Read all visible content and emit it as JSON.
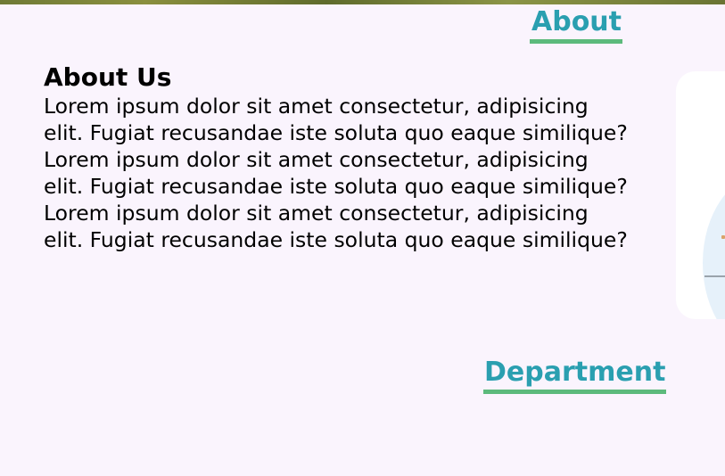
{
  "nav": {
    "about_label": "About",
    "department_label": "Department"
  },
  "about": {
    "title": "About Us",
    "paragraphs": [
      "Lorem ipsum dolor sit amet consectetur, adipisicing elit. Fugiat recusandae iste soluta quo eaque similique?",
      "Lorem ipsum dolor sit amet consectetur, adipisicing elit. Fugiat recusandae iste soluta quo eaque similique?",
      "Lorem ipsum dolor sit amet consectetur, adipisicing elit. Fugiat recusandae iste soluta quo eaque similique?"
    ]
  },
  "colors": {
    "background": "#faf4fd",
    "heading_link": "#2a9fb0",
    "underline": "#5cba7c",
    "card": "#ffffff"
  }
}
